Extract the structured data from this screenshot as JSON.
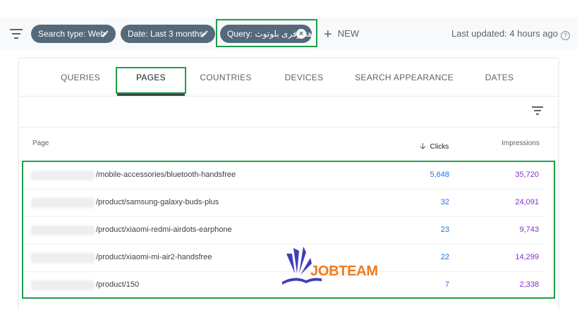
{
  "filter_bar": {
    "chips": [
      {
        "label": "Search type: Web"
      },
      {
        "label": "Date: Last 3 months"
      },
      {
        "label": "Query: هندزفری بلوتوث"
      }
    ],
    "new_label": "NEW",
    "last_updated": "Last updated: 4 hours ago"
  },
  "tabs": [
    "QUERIES",
    "PAGES",
    "COUNTRIES",
    "DEVICES",
    "SEARCH APPEARANCE",
    "DATES"
  ],
  "active_tab": "PAGES",
  "table": {
    "headers": {
      "page": "Page",
      "clicks": "Clicks",
      "impressions": "Impressions"
    },
    "rows": [
      {
        "page": "/mobile-accessories/bluetooth-handsfree",
        "clicks": "5,648",
        "impressions": "35,720"
      },
      {
        "page": "/product/samsung-galaxy-buds-plus",
        "clicks": "32",
        "impressions": "24,091"
      },
      {
        "page": "/product/xiaomi-redmi-airdots-earphone",
        "clicks": "23",
        "impressions": "9,743"
      },
      {
        "page": "/product/xiaomi-mi-air2-handsfree",
        "clicks": "22",
        "impressions": "14,299"
      },
      {
        "page": "/product/150",
        "clicks": "7",
        "impressions": "2,338"
      }
    ]
  },
  "watermark": {
    "text": "JOBTEAM"
  },
  "colors": {
    "chip": "#546a7b",
    "highlight": "#1e9e4a",
    "clicks": "#1a73e8",
    "impressions": "#8430ce",
    "watermark": "#f07a1c"
  }
}
